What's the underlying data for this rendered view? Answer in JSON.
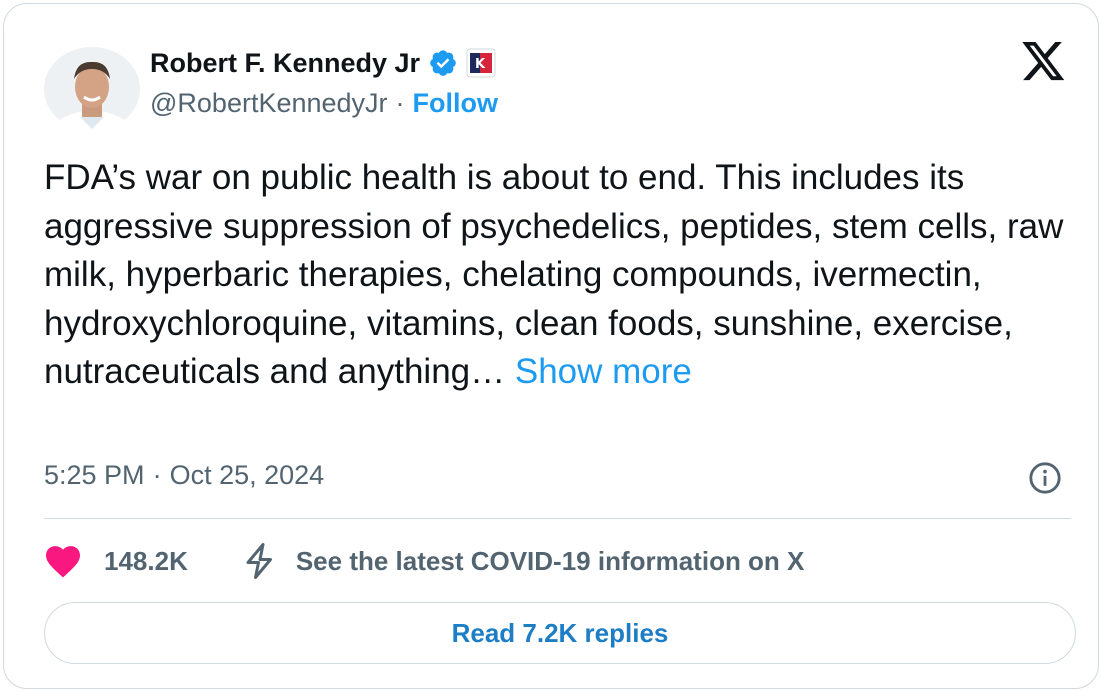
{
  "author": {
    "name": "Robert F. Kennedy Jr",
    "handle": "@RobertKennedyJr",
    "separator": "·",
    "follow_label": "Follow",
    "verified_icon": "verified-badge-icon",
    "affiliation_badge": "K24"
  },
  "tweet": {
    "text": "FDA’s war on public health is about to end. This includes its aggressive suppression of psychedelics, peptides, stem cells, raw milk, hyperbaric therapies, chelating compounds, ivermectin, hydroxychloroquine, vitamins, clean foods, sunshine, exercise, nutraceuticals and anything…",
    "show_more": "Show more",
    "time": "5:25 PM",
    "date": "Oct 25, 2024",
    "separator": "·"
  },
  "stats": {
    "likes": "148.2K",
    "covid_notice": "See the latest COVID-19 information on X"
  },
  "replies_button": "Read 7.2K replies",
  "colors": {
    "accent": "#1d9bf0",
    "text": "#0f1419",
    "muted": "#536471",
    "like": "#f91880",
    "border": "#cfd9de"
  }
}
